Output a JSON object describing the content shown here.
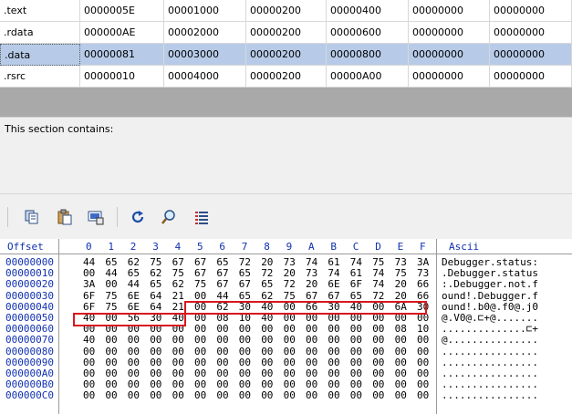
{
  "sections": {
    "rows": [
      {
        "name": ".text",
        "cells": [
          "0000005E",
          "00001000",
          "00000200",
          "00000400",
          "00000000",
          "00000000"
        ]
      },
      {
        "name": ".rdata",
        "cells": [
          "000000AE",
          "00002000",
          "00000200",
          "00000600",
          "00000000",
          "00000000"
        ]
      },
      {
        "name": ".data",
        "cells": [
          "00000081",
          "00003000",
          "00000200",
          "00000800",
          "00000000",
          "00000000"
        ],
        "selected": true
      },
      {
        "name": ".rsrc",
        "cells": [
          "00000010",
          "00004000",
          "00000200",
          "00000A00",
          "00000000",
          "00000000"
        ]
      }
    ]
  },
  "description": {
    "label": "This section contains:"
  },
  "toolbar": {
    "buttons": [
      "copy-icon",
      "paste-icon",
      "dump-icon",
      "refresh-icon",
      "search-icon",
      "list-icon"
    ]
  },
  "hex": {
    "offset_header": "Offset",
    "ascii_header": "Ascii",
    "columns": [
      "0",
      "1",
      "2",
      "3",
      "4",
      "5",
      "6",
      "7",
      "8",
      "9",
      "A",
      "B",
      "C",
      "D",
      "E",
      "F"
    ],
    "rows": [
      {
        "offset": "00000000",
        "bytes": [
          "44",
          "65",
          "62",
          "75",
          "67",
          "67",
          "65",
          "72",
          "20",
          "73",
          "74",
          "61",
          "74",
          "75",
          "73",
          "3A"
        ],
        "ascii": "Debugger.status:"
      },
      {
        "offset": "00000010",
        "bytes": [
          "00",
          "44",
          "65",
          "62",
          "75",
          "67",
          "67",
          "65",
          "72",
          "20",
          "73",
          "74",
          "61",
          "74",
          "75",
          "73"
        ],
        "ascii": ".Debugger.status"
      },
      {
        "offset": "00000020",
        "bytes": [
          "3A",
          "00",
          "44",
          "65",
          "62",
          "75",
          "67",
          "67",
          "65",
          "72",
          "20",
          "6E",
          "6F",
          "74",
          "20",
          "66"
        ],
        "ascii": ":.Debugger.not.f"
      },
      {
        "offset": "00000030",
        "bytes": [
          "6F",
          "75",
          "6E",
          "64",
          "21",
          "00",
          "44",
          "65",
          "62",
          "75",
          "67",
          "67",
          "65",
          "72",
          "20",
          "66"
        ],
        "ascii": "ound!.Debugger.f"
      },
      {
        "offset": "00000040",
        "bytes": [
          "6F",
          "75",
          "6E",
          "64",
          "21",
          "00",
          "62",
          "30",
          "40",
          "00",
          "66",
          "30",
          "40",
          "00",
          "6A",
          "30"
        ],
        "ascii": "ound!.b0@.f0@.j0"
      },
      {
        "offset": "00000050",
        "bytes": [
          "40",
          "00",
          "56",
          "30",
          "40",
          "00",
          "08",
          "10",
          "40",
          "00",
          "00",
          "00",
          "00",
          "00",
          "00",
          "00"
        ],
        "ascii": "@.V0@.⊏+@......."
      },
      {
        "offset": "00000060",
        "bytes": [
          "00",
          "00",
          "00",
          "00",
          "00",
          "00",
          "00",
          "00",
          "00",
          "00",
          "00",
          "00",
          "00",
          "00",
          "08",
          "10"
        ],
        "ascii": "..............⊏+"
      },
      {
        "offset": "00000070",
        "bytes": [
          "40",
          "00",
          "00",
          "00",
          "00",
          "00",
          "00",
          "00",
          "00",
          "00",
          "00",
          "00",
          "00",
          "00",
          "00",
          "00"
        ],
        "ascii": "@..............."
      },
      {
        "offset": "00000080",
        "bytes": [
          "00",
          "00",
          "00",
          "00",
          "00",
          "00",
          "00",
          "00",
          "00",
          "00",
          "00",
          "00",
          "00",
          "00",
          "00",
          "00"
        ],
        "ascii": "................"
      },
      {
        "offset": "00000090",
        "bytes": [
          "00",
          "00",
          "00",
          "00",
          "00",
          "00",
          "00",
          "00",
          "00",
          "00",
          "00",
          "00",
          "00",
          "00",
          "00",
          "00"
        ],
        "ascii": "................"
      },
      {
        "offset": "000000A0",
        "bytes": [
          "00",
          "00",
          "00",
          "00",
          "00",
          "00",
          "00",
          "00",
          "00",
          "00",
          "00",
          "00",
          "00",
          "00",
          "00",
          "00"
        ],
        "ascii": "................"
      },
      {
        "offset": "000000B0",
        "bytes": [
          "00",
          "00",
          "00",
          "00",
          "00",
          "00",
          "00",
          "00",
          "00",
          "00",
          "00",
          "00",
          "00",
          "00",
          "00",
          "00"
        ],
        "ascii": "................"
      },
      {
        "offset": "000000C0",
        "bytes": [
          "00",
          "00",
          "00",
          "00",
          "00",
          "00",
          "00",
          "00",
          "00",
          "00",
          "00",
          "00",
          "00",
          "00",
          "00",
          "00"
        ],
        "ascii": "................"
      }
    ]
  },
  "colors": {
    "highlight": "#d9161e",
    "selected_row": "#b7cbe8",
    "offset_blue": "#1030b0"
  }
}
